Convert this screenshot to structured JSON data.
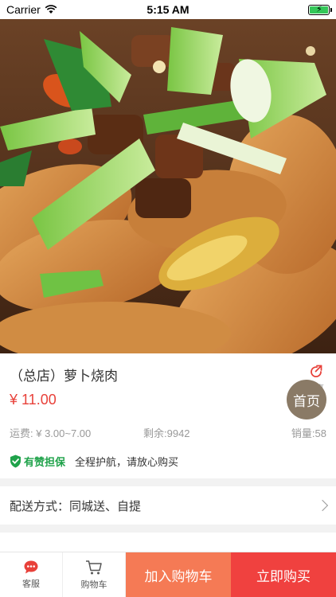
{
  "status_bar": {
    "carrier": "Carrier",
    "time": "5:15 AM"
  },
  "hero": {
    "icon": "braised-pork-radish-photo"
  },
  "product": {
    "title": "（总店）萝卜烧肉",
    "price": "¥ 11.00",
    "share_label": "分享",
    "home_label": "首页",
    "shipping": "运费: ¥ 3.00~7.00",
    "stock": "剩余:9942",
    "sales": "销量:58"
  },
  "guarantee": {
    "title": "有赞担保",
    "desc": "全程护航，请放心购买",
    "color": "#1fa24a"
  },
  "delivery": {
    "label": "配送方式：",
    "value": "同城送、自提"
  },
  "bottom_bar": {
    "service_label": "客服",
    "cart_label": "购物车",
    "add_cart_label": "加入购物车",
    "buy_now_label": "立即购买",
    "add_cart_color": "#f57a55",
    "buy_now_color": "#f0413f"
  },
  "colors": {
    "price": "#e8413a",
    "accent": "#e8413a"
  }
}
